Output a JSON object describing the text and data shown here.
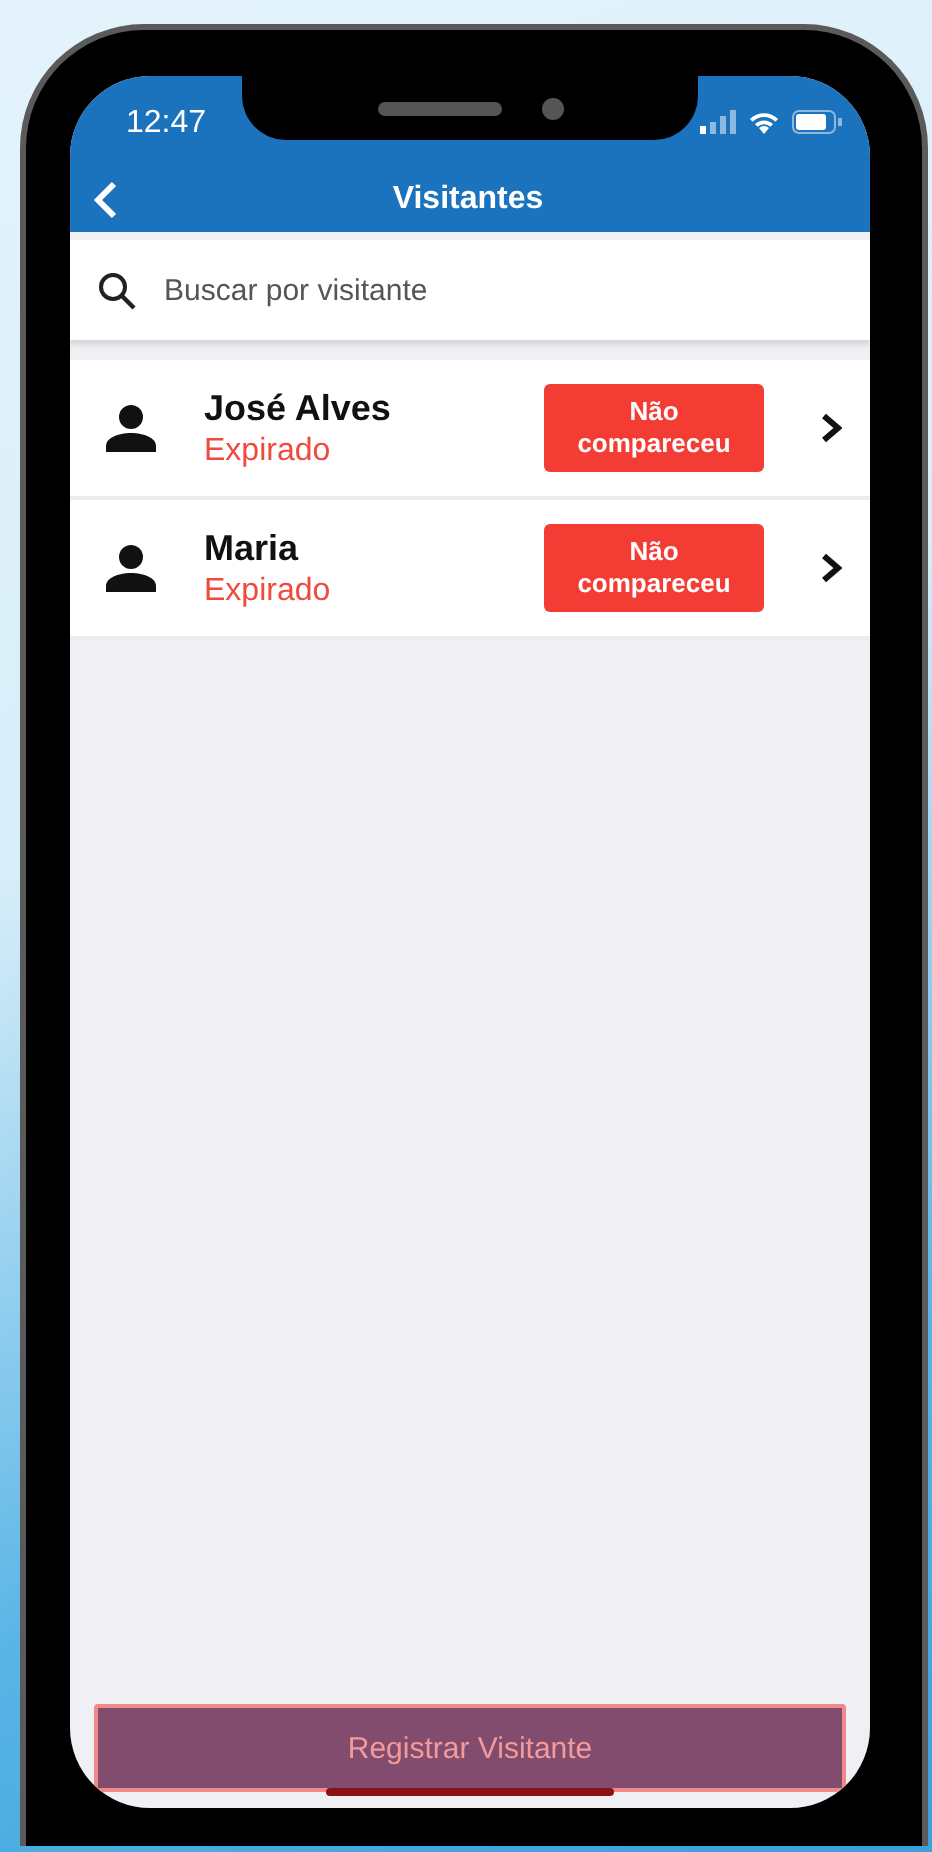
{
  "status_bar": {
    "time": "12:47"
  },
  "nav_bar": {
    "title": "Visitantes"
  },
  "search": {
    "placeholder": "Buscar por visitante"
  },
  "visitors": [
    {
      "name": "José Alves",
      "status": "Expirado",
      "badge": "Não compareceu"
    },
    {
      "name": "Maria",
      "status": "Expirado",
      "badge": "Não compareceu"
    }
  ],
  "register_button": {
    "label": "Registrar Visitante"
  }
}
